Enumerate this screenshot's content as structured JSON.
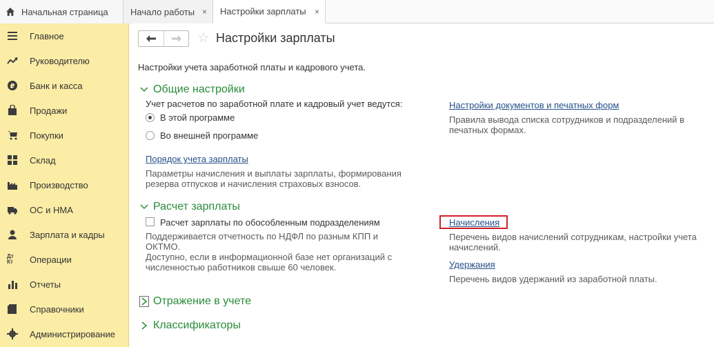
{
  "tabs": {
    "home_label": "Начальная страница",
    "tab1_label": "Начало работы",
    "tab2_label": "Настройки зарплаты",
    "close_glyph": "×"
  },
  "sidebar": {
    "items": [
      {
        "label": "Главное",
        "icon": "menu-lines-icon"
      },
      {
        "label": "Руководителю",
        "icon": "trend-icon"
      },
      {
        "label": "Банк и касса",
        "icon": "coin-icon"
      },
      {
        "label": "Продажи",
        "icon": "shopping-bag-icon"
      },
      {
        "label": "Покупки",
        "icon": "cart-icon"
      },
      {
        "label": "Склад",
        "icon": "grid-icon"
      },
      {
        "label": "Производство",
        "icon": "factory-icon"
      },
      {
        "label": "ОС и НМА",
        "icon": "truck-icon"
      },
      {
        "label": "Зарплата и кадры",
        "icon": "person-icon"
      },
      {
        "label": "Операции",
        "icon": "dt-kt-icon"
      },
      {
        "label": "Отчеты",
        "icon": "bar-chart-icon"
      },
      {
        "label": "Справочники",
        "icon": "book-icon"
      },
      {
        "label": "Администрирование",
        "icon": "gear-icon"
      }
    ],
    "operations_glyph": "Дт Кт"
  },
  "header": {
    "title": "Настройки зарплаты"
  },
  "intro": "Настройки учета заработной платы и кадрового учета.",
  "general": {
    "title": "Общие настройки",
    "question": "Учет расчетов по заработной плате и кадровый учет ведутся:",
    "option1": "В этой программе",
    "option2": "Во внешней программе",
    "selected": "В этой программе",
    "link_order": "Порядок учета зарплаты",
    "order_desc": "Параметры начисления и выплаты зарплаты, формирования резерва отпусков и начисления страховых взносов.",
    "link_docs": "Настройки документов и печатных форм",
    "docs_desc": "Правила вывода списка сотрудников и подразделений в печатных формах."
  },
  "calc": {
    "title": "Расчет зарплаты",
    "checkbox_label": "Расчет зарплаты по обособленным подразделениям",
    "checkbox_checked": false,
    "checkbox_desc": "Поддерживается отчетность по НДФЛ по разным КПП и ОКТМО.\nДоступно, если в информационной базе нет организаций с численностью работников свыше 60 человек.",
    "link_accruals": "Начисления",
    "accruals_desc": "Перечень видов начислений сотрудникам, настройки учета начислений.",
    "link_deductions": "Удержания",
    "deductions_desc": "Перечень видов удержаний из заработной платы."
  },
  "sections": {
    "reflection": "Отражение в учете",
    "classifiers": "Классификаторы"
  },
  "colors": {
    "sidebar_bg": "#fbeca6",
    "section_green": "#2a8b3a",
    "link_blue": "#26508a",
    "highlight_red": "#d21f2a"
  }
}
